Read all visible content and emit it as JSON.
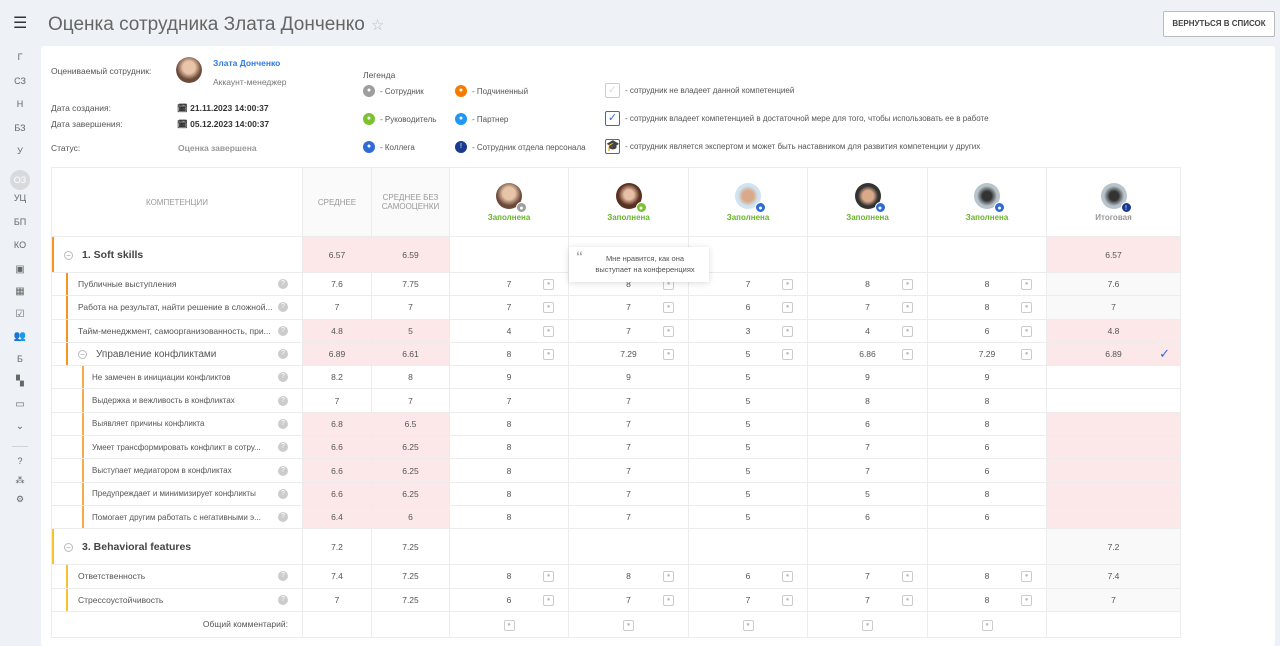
{
  "page": {
    "title": "Оценка сотрудника Злата Донченко",
    "back_button": "ВЕРНУТЬСЯ В СПИСОК"
  },
  "sidebar": {
    "items": [
      "Г",
      "СЗ",
      "Н",
      "БЗ",
      "У",
      "ОЗ",
      "УЦ",
      "БП",
      "КО"
    ],
    "icon_items": [
      "id-card-icon",
      "calendar-icon",
      "checkbox-icon",
      "team-icon"
    ],
    "b_item": "Б",
    "icon_items2": [
      "grid-icon",
      "window-icon",
      "chevron-down-circle-icon"
    ],
    "bottom_icons": [
      "help-icon",
      "structure-icon",
      "gear-icon"
    ],
    "active": "ОЗ"
  },
  "info": {
    "employee_label": "Оцениваемый сотрудник:",
    "employee_name": "Злата Донченко",
    "employee_role": "Аккаунт-менеджер",
    "created_label": "Дата создания:",
    "created": "21.11.2023 14:00:37",
    "finished_label": "Дата завершения:",
    "finished": "05.12.2023 14:00:37",
    "status_label": "Статус:",
    "status": "Оценка завершена"
  },
  "legend": {
    "title": "Легенда",
    "roles": [
      {
        "label": "- Сотрудник",
        "color": "#9e9e9e"
      },
      {
        "label": "- Подчиненный",
        "color": "#f57c00"
      },
      {
        "label": "- Руководитель",
        "color": "#7cc230"
      },
      {
        "label": "- Партнер",
        "color": "#2196f3"
      },
      {
        "label": "- Коллега",
        "color": "#2f6bd6"
      },
      {
        "label": "- Сотрудник отдела персонала",
        "color": "#1a3a8f"
      }
    ],
    "levels": [
      "- сотрудник не владеет данной компетенцией",
      "- сотрудник владеет компетенцией в достаточной мере для того, чтобы использовать ее в работе",
      "- сотрудник является экспертом и может быть наставником для развития компетенции у других"
    ]
  },
  "table": {
    "headers": {
      "competencies": "КОМПЕТЕНЦИИ",
      "avg": "СРЕДНЕЕ",
      "avg_no_self": "СРЕДНЕЕ БЕЗ САМООЦЕНКИ"
    },
    "evaluators": [
      {
        "status": "Заполнена",
        "role": "employee"
      },
      {
        "status": "Заполнена",
        "role": "manager"
      },
      {
        "status": "Заполнена",
        "role": "colleague"
      },
      {
        "status": "Заполнена",
        "role": "colleague"
      },
      {
        "status": "Заполнена",
        "role": "colleague"
      }
    ],
    "final_label": "Итоговая",
    "rows": [
      {
        "type": "group",
        "name": "1. Soft skills",
        "avg": "6.57",
        "avg2": "6.59",
        "scores": [
          "",
          "",
          "",
          "",
          ""
        ],
        "final": "6.57",
        "pink": true,
        "bar": "#f7931e"
      },
      {
        "type": "item",
        "name": "Публичные выступления",
        "avg": "7.6",
        "avg2": "7.75",
        "scores": [
          "7",
          "8",
          "7",
          "8",
          "8"
        ],
        "final": "7.6",
        "comments": true
      },
      {
        "type": "item",
        "name": "Работа на результат, найти решение в сложной...",
        "avg": "7",
        "avg2": "7",
        "scores": [
          "7",
          "7",
          "6",
          "7",
          "8"
        ],
        "final": "7",
        "comments": true
      },
      {
        "type": "item",
        "name": "Тайм-менеджмент, самоорганизованность, при...",
        "avg": "4.8",
        "avg2": "5",
        "scores": [
          "4",
          "7",
          "3",
          "4",
          "6"
        ],
        "final": "4.8",
        "pink": true,
        "comments": true
      },
      {
        "type": "subgroup",
        "name": "Управление конфликтами",
        "avg": "6.89",
        "avg2": "6.61",
        "scores": [
          "8",
          "7.29",
          "5",
          "6.86",
          "7.29"
        ],
        "final": "6.89",
        "pink": true,
        "comments": true,
        "checked": true
      },
      {
        "type": "sub",
        "name": "Не замечен в инициации конфликтов",
        "avg": "8.2",
        "avg2": "8",
        "scores": [
          "9",
          "9",
          "5",
          "9",
          "9"
        ],
        "final": ""
      },
      {
        "type": "sub",
        "name": "Выдержка и вежливость в конфликтах",
        "avg": "7",
        "avg2": "7",
        "scores": [
          "7",
          "7",
          "5",
          "8",
          "8"
        ],
        "final": ""
      },
      {
        "type": "sub",
        "name": "Выявляет причины конфликта",
        "avg": "6.8",
        "avg2": "6.5",
        "scores": [
          "8",
          "7",
          "5",
          "6",
          "8"
        ],
        "final": "",
        "pink": true
      },
      {
        "type": "sub",
        "name": "Умеет трансформировать конфликт в сотру...",
        "avg": "6.6",
        "avg2": "6.25",
        "scores": [
          "8",
          "7",
          "5",
          "7",
          "6"
        ],
        "final": "",
        "pink": true
      },
      {
        "type": "sub",
        "name": "Выступает медиатором в конфликтах",
        "avg": "6.6",
        "avg2": "6.25",
        "scores": [
          "8",
          "7",
          "5",
          "7",
          "6"
        ],
        "final": "",
        "pink": true
      },
      {
        "type": "sub",
        "name": "Предупреждает и минимизирует конфликты",
        "avg": "6.6",
        "avg2": "6.25",
        "scores": [
          "8",
          "7",
          "5",
          "5",
          "8"
        ],
        "final": "",
        "pink": true
      },
      {
        "type": "sub",
        "name": "Помогает другим работать с негативными э...",
        "avg": "6.4",
        "avg2": "6",
        "scores": [
          "8",
          "7",
          "5",
          "6",
          "6"
        ],
        "final": "",
        "pink": true
      },
      {
        "type": "group",
        "name": "3. Behavioral features",
        "avg": "7.2",
        "avg2": "7.25",
        "scores": [
          "",
          "",
          "",
          "",
          ""
        ],
        "final": "7.2",
        "bar": "#fbc02d"
      },
      {
        "type": "item",
        "name": "Ответственность",
        "avg": "7.4",
        "avg2": "7.25",
        "scores": [
          "8",
          "8",
          "6",
          "7",
          "8"
        ],
        "final": "7.4",
        "comments": true,
        "bar": "#fbc02d"
      },
      {
        "type": "item",
        "name": "Стрессоустойчивость",
        "avg": "7",
        "avg2": "7.25",
        "scores": [
          "6",
          "7",
          "7",
          "7",
          "8"
        ],
        "final": "7",
        "comments": true,
        "bar": "#fbc02d"
      }
    ],
    "general_comment": "Общий комментарий:"
  },
  "tooltip": {
    "text": "Мне нравится, как она выступает на конференциях"
  }
}
